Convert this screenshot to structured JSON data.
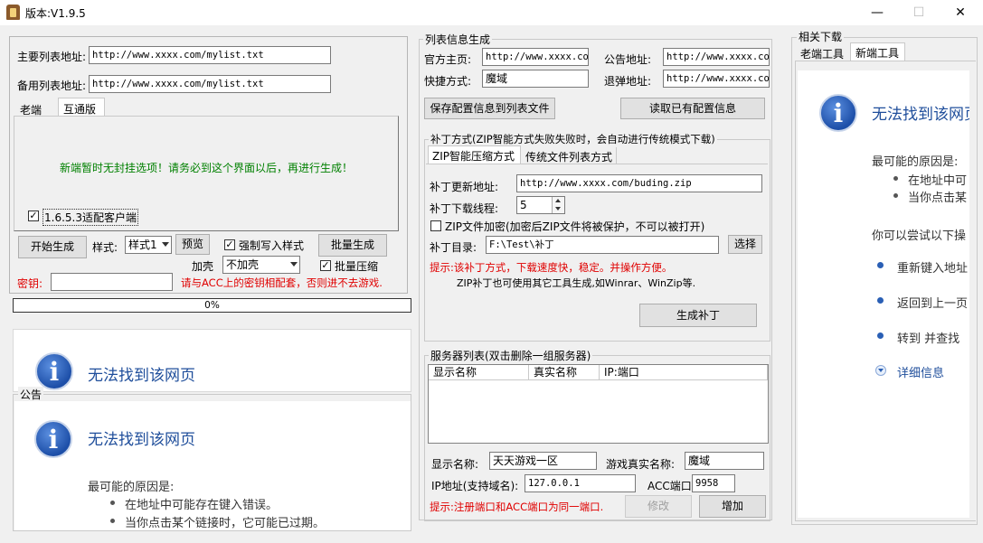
{
  "window": {
    "title": "版本:V1.9.5",
    "minimize": "—",
    "maximize": "☐",
    "close": "✕"
  },
  "left": {
    "main_list_label": "主要列表地址:",
    "main_list_value": "http://www.xxxx.com/mylist.txt",
    "backup_list_label": "备用列表地址:",
    "backup_list_value": "http://www.xxxx.com/mylist.txt",
    "tabs": [
      "老端",
      "互通版"
    ],
    "notice": "新端暂时无封挂选项！请务必到这个界面以后，再进行生成！",
    "client_check_label": "1.6.5.3适配客户端",
    "client_checked": true,
    "start_button": "开始生成",
    "style_label": "样式:",
    "style_value": "样式1",
    "preview_button": "预览",
    "force_style_label": "强制写入样式",
    "force_style_checked": true,
    "batch_button": "批量生成",
    "shell_label": "加壳",
    "shell_value": "不加壳",
    "batch_compress_label": "批量压缩",
    "batch_compress_checked": true,
    "key_label": "密钥:",
    "key_value": "",
    "key_hint": "请与ACC上的密钥相配套，否则进不去游戏.",
    "progress_text": "0%",
    "progress_value": 0,
    "notice_group_label": "公告"
  },
  "ie_error": {
    "title": "无法找到该网页",
    "reasons_header": "最可能的原因是:",
    "reasons": [
      "在地址中可能存在键入错误。",
      "当你点击某个链接时，它可能已过期。"
    ],
    "right_reasons": [
      "在地址中可",
      "当你点击某"
    ],
    "try_text": "你可以尝试以下操",
    "actions": [
      "重新键入地址",
      "返回到上一页",
      "转到  并查找"
    ],
    "more_info": "详细信息"
  },
  "listinfo": {
    "group_label": "列表信息生成",
    "homepage_label": "官方主页:",
    "homepage_value": "http://www.xxxx.com",
    "announce_label": "公告地址:",
    "announce_value": "http://www.xxxx.com",
    "shortcut_label": "快捷方式:",
    "shortcut_value": "魔域",
    "bounce_label": "退弹地址:",
    "bounce_value": "http://www.xxxx.com",
    "save_button": "保存配置信息到列表文件",
    "read_button": "读取已有配置信息"
  },
  "patch": {
    "group_label": "补丁方式(ZIP智能方式失败失败时，会自动进行传统模式下载)",
    "tabs": [
      "ZIP智能压缩方式",
      "传统文件列表方式"
    ],
    "update_label": "补丁更新地址:",
    "update_value": "http://www.xxxx.com/buding.zip",
    "threads_label": "补丁下载线程:",
    "threads_value": "5",
    "encrypt_label": "ZIP文件加密(加密后ZIP文件将被保护，不可以被打开)",
    "encrypt_checked": false,
    "dir_label": "补丁目录:",
    "dir_value": "F:\\Test\\补丁",
    "select_button": "选择",
    "hint1": "提示:该补丁方式，下载速度快，稳定。并操作方便。",
    "hint2": "ZIP补丁也可使用其它工具生成,如Winrar、WinZip等.",
    "generate_button": "生成补丁"
  },
  "servers": {
    "group_label": "服务器列表(双击删除一组服务器)",
    "columns": [
      "显示名称",
      "真实名称",
      "IP:端口"
    ],
    "rows": [],
    "display_label": "显示名称:",
    "display_value": "天天游戏一区",
    "real_label": "游戏真实名称:",
    "real_value": "魔域",
    "ip_label": "IP地址(支持域名):",
    "ip_value": "127.0.0.1",
    "acc_label": "ACC端口:",
    "acc_value": "9958",
    "hint": "提示:注册端口和ACC端口为同一端口.",
    "modify_button": "修改",
    "add_button": "增加"
  },
  "downloads": {
    "group_label": "相关下载",
    "tabs": [
      "老端工具",
      "新端工具"
    ]
  }
}
